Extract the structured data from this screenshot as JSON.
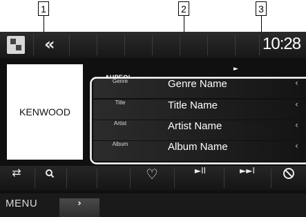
{
  "callouts": [
    "1",
    "2",
    "3"
  ],
  "header": {
    "source_icon": "music-source-icon",
    "back_icon": "«",
    "clock": "10:28"
  },
  "now_playing": {
    "artwork_text": "KENWOOD",
    "service_logo": "AUPEO!",
    "play_indicator": "►"
  },
  "track_info": [
    {
      "label": "Genre",
      "value": "Genre Name",
      "arrow": "‹"
    },
    {
      "label": "Title",
      "value": "Title Name",
      "arrow": "‹"
    },
    {
      "label": "Artist",
      "value": "Artist Name",
      "arrow": "‹"
    },
    {
      "label": "Album",
      "value": "Album Name",
      "arrow": "‹"
    }
  ],
  "controls": {
    "source_switch": "⇄",
    "search": "🔍",
    "love": "♡",
    "play_pause": "►II",
    "skip": "►►I",
    "ban": "⃠"
  },
  "bottom": {
    "menu": "MENU",
    "next_tab": "›"
  },
  "colors": {
    "screen_bg": "#101010",
    "info_border": "#ffffff",
    "text": "#ffffff"
  }
}
